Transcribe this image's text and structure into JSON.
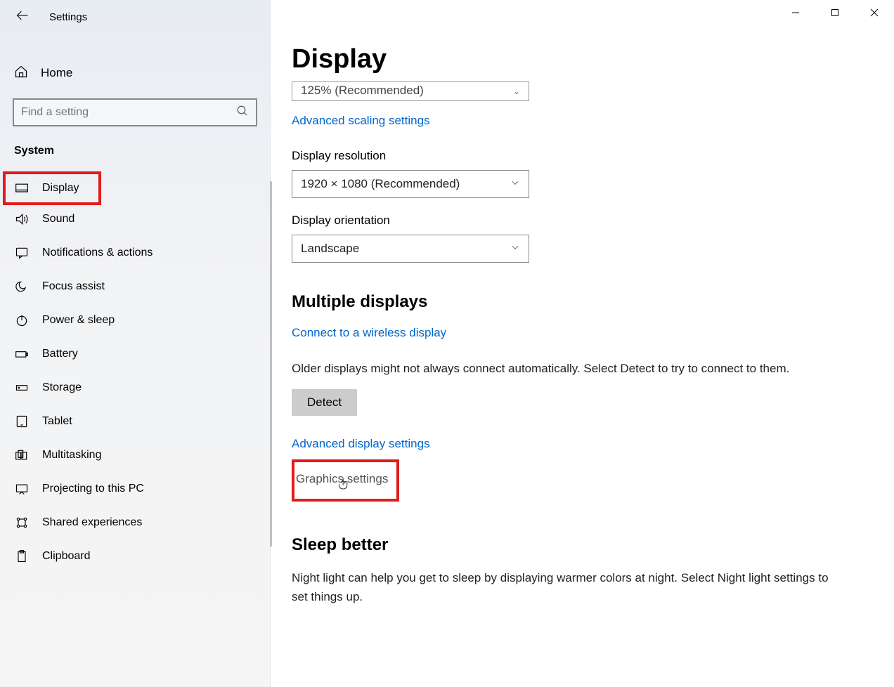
{
  "window": {
    "app_title": "Settings"
  },
  "sidebar": {
    "home_label": "Home",
    "search_placeholder": "Find a setting",
    "category": "System",
    "items": [
      {
        "label": "Display",
        "icon": "monitor-icon",
        "selected": true
      },
      {
        "label": "Sound",
        "icon": "sound-icon"
      },
      {
        "label": "Notifications & actions",
        "icon": "chat-icon"
      },
      {
        "label": "Focus assist",
        "icon": "moon-icon"
      },
      {
        "label": "Power & sleep",
        "icon": "power-icon"
      },
      {
        "label": "Battery",
        "icon": "battery-icon"
      },
      {
        "label": "Storage",
        "icon": "storage-icon"
      },
      {
        "label": "Tablet",
        "icon": "tablet-icon"
      },
      {
        "label": "Multitasking",
        "icon": "multitask-icon"
      },
      {
        "label": "Projecting to this PC",
        "icon": "project-icon"
      },
      {
        "label": "Shared experiences",
        "icon": "share-icon"
      },
      {
        "label": "Clipboard",
        "icon": "clipboard-icon"
      }
    ]
  },
  "main": {
    "page_title": "Display",
    "cutoff_select_value": "125% (Recommended)",
    "link_advanced_scaling": "Advanced scaling settings",
    "resolution_label": "Display resolution",
    "resolution_value": "1920 × 1080 (Recommended)",
    "orientation_label": "Display orientation",
    "orientation_value": "Landscape",
    "multiple_title": "Multiple displays",
    "link_wireless": "Connect to a wireless display",
    "detect_hint": "Older displays might not always connect automatically. Select Detect to try to connect to them.",
    "detect_button": "Detect",
    "link_advanced_display": "Advanced display settings",
    "link_graphics": "Graphics settings",
    "sleep_title": "Sleep better",
    "sleep_body": "Night light can help you get to sleep by displaying warmer colors at night. Select Night light settings to set things up."
  }
}
